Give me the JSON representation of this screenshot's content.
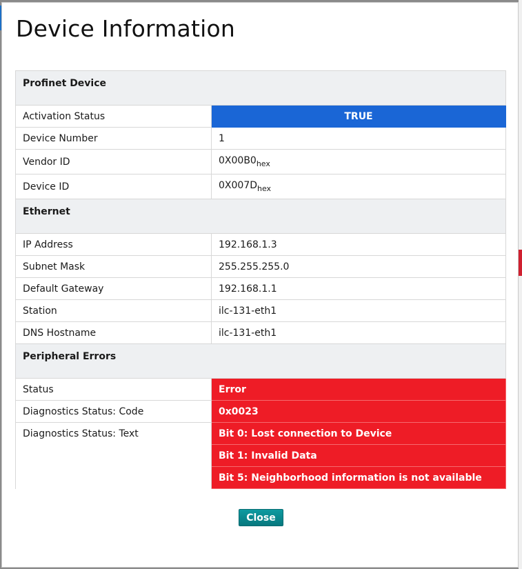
{
  "dialog": {
    "title": "Device Information",
    "close_label": "Close"
  },
  "sections": {
    "profinet": {
      "title": "Profinet Device",
      "activation_status": {
        "label": "Activation Status",
        "value": "TRUE"
      },
      "device_number": {
        "label": "Device Number",
        "value": "1"
      },
      "vendor_id": {
        "label": "Vendor ID",
        "value": "0X00B0",
        "suffix": "hex"
      },
      "device_id": {
        "label": "Device ID",
        "value": "0X007D",
        "suffix": "hex"
      }
    },
    "ethernet": {
      "title": "Ethernet",
      "ip_address": {
        "label": "IP Address",
        "value": "192.168.1.3"
      },
      "subnet_mask": {
        "label": "Subnet Mask",
        "value": "255.255.255.0"
      },
      "default_gateway": {
        "label": "Default Gateway",
        "value": "192.168.1.1"
      },
      "station": {
        "label": "Station",
        "value": "ilc-131-eth1"
      },
      "dns_hostname": {
        "label": "DNS Hostname",
        "value": "ilc-131-eth1"
      }
    },
    "peripheral": {
      "title": "Peripheral Errors",
      "status": {
        "label": "Status",
        "value": "Error"
      },
      "diag_code": {
        "label": "Diagnostics Status: Code",
        "value": "0x0023"
      },
      "diag_text": {
        "label": "Diagnostics Status: Text",
        "values": [
          "Bit 0: Lost connection to Device",
          "Bit 1: Invalid Data",
          "Bit 5: Neighborhood information is not available"
        ]
      }
    }
  },
  "colors": {
    "true_badge": "#1a66d6",
    "error_badge": "#ee1c26",
    "section_header": "#eef0f2",
    "close_button": "#0a8a90"
  }
}
